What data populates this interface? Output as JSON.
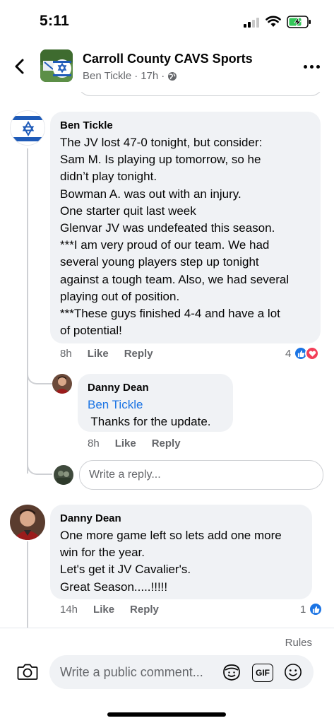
{
  "status_bar": {
    "time": "5:11"
  },
  "header": {
    "group_name": "Carroll County CAVS Sports",
    "author": "Ben Tickle",
    "time": "17h",
    "separator": "·"
  },
  "comments": [
    {
      "author": "Ben Tickle",
      "lines": [
        "The JV lost 47-0 tonight, but consider:",
        "Sam M. Is playing up tomorrow, so he",
        "didn’t play tonight.",
        "Bowman A. was out with an injury.",
        "One starter quit last week",
        "Glenvar JV was undefeated this season.",
        "***I am very proud of our team. We had",
        "several young players step up tonight",
        "against a tough team. Also, we had several",
        "playing out of position.",
        "***These guys finished 4-4 and have a lot",
        "of potential!"
      ],
      "time": "8h",
      "like_label": "Like",
      "reply_label": "Reply",
      "reaction_count": "4",
      "reactions": [
        "like-icon",
        "love-icon"
      ]
    },
    {
      "author": "Danny Dean",
      "mention": "Ben Tickle",
      "text": " Thanks for the update.",
      "time": "8h",
      "like_label": "Like",
      "reply_label": "Reply"
    },
    {
      "author": "Danny Dean",
      "lines": [
        "One more game left so lets add one more",
        "win for the year.",
        "Let's get it JV Cavalier's.",
        "Great Season.....!!!!!"
      ],
      "time": "14h",
      "like_label": "Like",
      "reply_label": "Reply",
      "reaction_count": "1",
      "reactions": [
        "like-icon"
      ]
    }
  ],
  "reply_input": {
    "placeholder": "Write a reply..."
  },
  "composer": {
    "rules_label": "Rules",
    "placeholder": "Write a public comment...",
    "gif_label": "GIF"
  },
  "colors": {
    "like_blue": "#1b74e4",
    "love_red": "#f33e58",
    "bubble_gray": "#f0f2f5",
    "flag_blue": "#1f5bb8"
  }
}
